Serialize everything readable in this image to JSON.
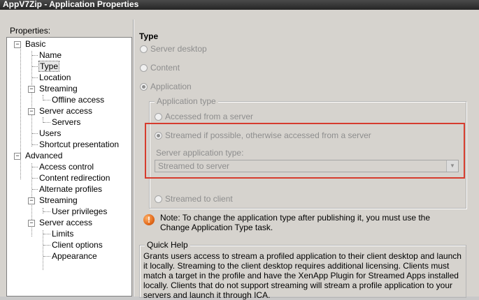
{
  "window": {
    "title": "AppV7Zip - Application Properties"
  },
  "left": {
    "label": "Properties:",
    "tree": [
      {
        "label": "Basic",
        "expander": "−"
      },
      {
        "label": "Name"
      },
      {
        "label": "Type",
        "selected": true
      },
      {
        "label": "Location"
      },
      {
        "label": "Streaming",
        "expander": "−"
      },
      {
        "label": "Offline access"
      },
      {
        "label": "Server access",
        "expander": "−"
      },
      {
        "label": "Servers"
      },
      {
        "label": "Users"
      },
      {
        "label": "Shortcut presentation"
      },
      {
        "label": "Advanced",
        "expander": "−"
      },
      {
        "label": "Access control"
      },
      {
        "label": "Content redirection"
      },
      {
        "label": "Alternate profiles"
      },
      {
        "label": "Streaming",
        "expander": "−"
      },
      {
        "label": "User privileges"
      },
      {
        "label": "Server access",
        "expander": "−"
      },
      {
        "label": "Limits"
      },
      {
        "label": "Client options"
      },
      {
        "label": "Appearance"
      }
    ]
  },
  "right": {
    "title": "Type",
    "radios": {
      "server_desktop": "Server desktop",
      "content": "Content",
      "application": "Application"
    },
    "app_type_group": {
      "legend": "Application type",
      "accessed_from_server": "Accessed from a server",
      "streamed_if_possible": "Streamed if possible, otherwise accessed from a server",
      "server_app_type_label": "Server application type:",
      "server_app_type_value": "Streamed to server",
      "streamed_to_client": "Streamed to client"
    },
    "note": "Note: To change the application type after publishing it, you must use the Change Application Type task.",
    "quick_help": {
      "legend": "Quick Help",
      "text": "Grants users access to stream a profiled application to their client desktop and launch it locally. Streaming to the client desktop requires additional licensing. Clients must match a target in the profile and have the XenApp Plugin for Streamed Apps installed locally. Clients that do not support streaming will stream a profile application to your servers and launch it through ICA."
    }
  },
  "colors": {
    "highlight": "#d63c2e",
    "titlebar": "#262626"
  }
}
